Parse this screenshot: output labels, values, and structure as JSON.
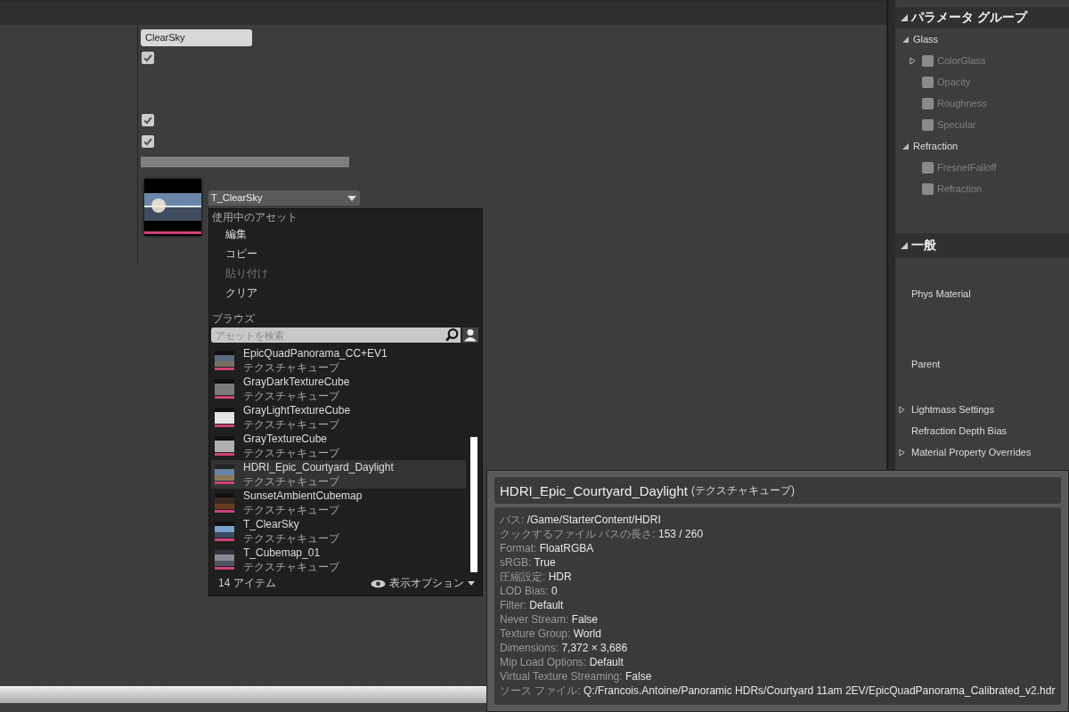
{
  "details": {
    "name_field": {
      "value": "ClearSky"
    },
    "checkboxes": [
      {
        "checked": true
      },
      {
        "checked": true
      },
      {
        "checked": true
      }
    ],
    "texture_picker": {
      "value": "T_ClearSky"
    }
  },
  "asset_menu": {
    "section_current": "使用中のアセット",
    "actions": [
      {
        "label": "編集",
        "disabled": false
      },
      {
        "label": "コピー",
        "disabled": false
      },
      {
        "label": "貼り付け",
        "disabled": true
      },
      {
        "label": "クリア",
        "disabled": false
      }
    ],
    "section_browse": "ブラウズ",
    "search": {
      "placeholder": "アセットを検索"
    },
    "assets": [
      {
        "name": "EpicQuadPanorama_CC+EV1",
        "type": "テクスチャキューブ",
        "selected": false
      },
      {
        "name": "GrayDarkTextureCube",
        "type": "テクスチャキューブ",
        "selected": false
      },
      {
        "name": "GrayLightTextureCube",
        "type": "テクスチャキューブ",
        "selected": false
      },
      {
        "name": "GrayTextureCube",
        "type": "テクスチャキューブ",
        "selected": false
      },
      {
        "name": "HDRI_Epic_Courtyard_Daylight",
        "type": "テクスチャキューブ",
        "selected": true
      },
      {
        "name": "SunsetAmbientCubemap",
        "type": "テクスチャキューブ",
        "selected": false
      },
      {
        "name": "T_ClearSky",
        "type": "テクスチャキューブ",
        "selected": false
      },
      {
        "name": "T_Cubemap_01",
        "type": "テクスチャキューブ",
        "selected": false
      }
    ],
    "item_count": "14 アイテム",
    "view_options": "表示オプション"
  },
  "parameter_groups": {
    "title": "パラメータ グループ",
    "expanded": true,
    "groups": [
      {
        "label": "Glass",
        "expanded": true,
        "children": [
          {
            "label": "ColorGlass",
            "checked": false,
            "expandable": true
          },
          {
            "label": "Opacity",
            "checked": false,
            "expandable": false
          },
          {
            "label": "Roughness",
            "checked": false,
            "expandable": false
          },
          {
            "label": "Specular",
            "checked": false,
            "expandable": false
          }
        ]
      },
      {
        "label": "Refraction",
        "expanded": true,
        "children": [
          {
            "label": "FresnelFalloff",
            "checked": false,
            "expandable": false
          },
          {
            "label": "Refraction",
            "checked": false,
            "expandable": false
          }
        ]
      }
    ]
  },
  "general": {
    "title": "一般",
    "expanded": true,
    "properties": [
      {
        "label": "Phys Material",
        "expandable": false
      },
      {
        "label": "Parent",
        "expandable": false
      },
      {
        "label": "Lightmass Settings",
        "expandable": true
      },
      {
        "label": "Refraction Depth Bias",
        "expandable": false
      },
      {
        "label": "Material Property Overrides",
        "expandable": true
      }
    ]
  },
  "tooltip": {
    "title": "HDRI_Epic_Courtyard_Daylight",
    "type": "(テクスチャキューブ)",
    "rows": [
      {
        "label": "パス:",
        "value": "/Game/StarterContent/HDRI"
      },
      {
        "label": "クックするファイル パスの長さ:",
        "value": "153 / 260"
      },
      {
        "label": "Format:",
        "value": "FloatRGBA"
      },
      {
        "label": "sRGB:",
        "value": "True"
      },
      {
        "label": "圧縮設定:",
        "value": "HDR"
      },
      {
        "label": "LOD Bias:",
        "value": "0"
      },
      {
        "label": "Filter:",
        "value": "Default"
      },
      {
        "label": "Never Stream:",
        "value": "False"
      },
      {
        "label": "Texture Group:",
        "value": "World"
      },
      {
        "label": "Dimensions:",
        "value": "7,372 × 3,686"
      },
      {
        "label": "Mip Load Options:",
        "value": "Default"
      },
      {
        "label": "Virtual Texture Streaming:",
        "value": "False"
      },
      {
        "label": "ソース ファイル:",
        "value": "Q:/Francois.Antoine/Panoramic HDRs/Courtyard  11am 2EV/EpicQuadPanorama_Calibrated_v2.hdr"
      }
    ]
  }
}
